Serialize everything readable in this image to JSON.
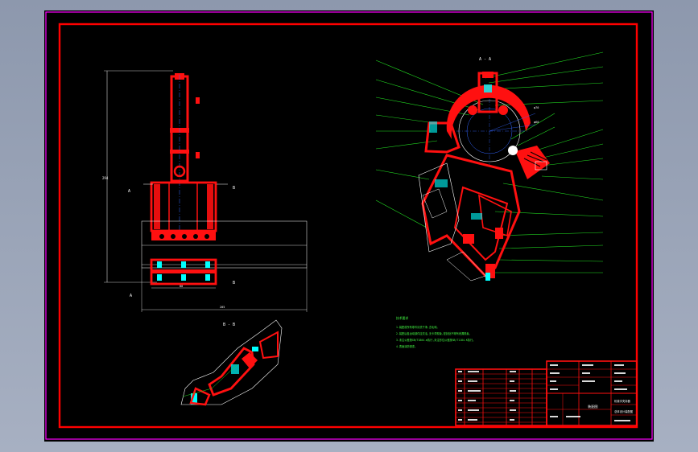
{
  "views": {
    "section_aa": "A - A",
    "section_bb": "B - B",
    "cut_marks": [
      "A",
      "B",
      "A",
      "B"
    ]
  },
  "notes": {
    "heading": "技术要求",
    "lines": [
      "1.装配前所有零件清洗干净,去毛刺。",
      "2.装配后各运动部件应灵活,无卡滞现象,密封处不得有泄漏现象。",
      "3.未注公差按GB/T1804-m执行,未注形位公差按GB/T1184-K执行。",
      "4.表面涂防锈漆。"
    ]
  },
  "title_block": {
    "drawing_name": "装配图",
    "company_line1": "机械手夹持器",
    "company_line2": "总体设计装配图"
  },
  "colors": {
    "frame": "#ff0000",
    "border": "#ff00ff",
    "leader": "#22dd22",
    "centerline": "#3366ff",
    "annotation": "#ffffff",
    "part_fill": "#ff1010",
    "hardware": "#00ffff"
  }
}
